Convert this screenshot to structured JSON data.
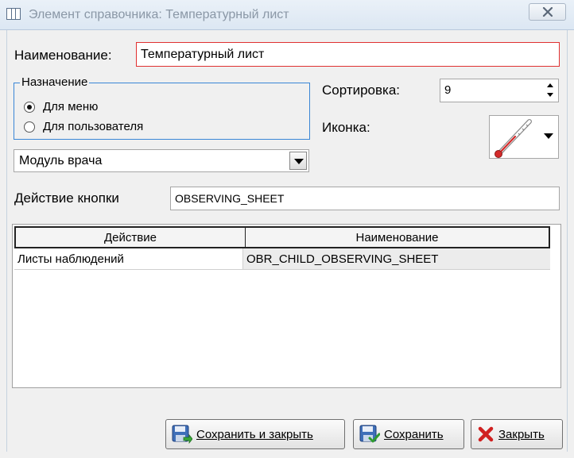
{
  "window": {
    "title": "Элемент справочника: Температурный лист",
    "icon": "table-icon",
    "close_icon": "close-icon"
  },
  "form": {
    "name_label": "Наименование:",
    "name_value": "Температурный лист",
    "purpose": {
      "legend": "Назначение",
      "options": [
        {
          "label": "Для меню",
          "checked": true
        },
        {
          "label": "Для пользователя",
          "checked": false
        }
      ]
    },
    "sort_label": "Сортировка:",
    "sort_value": "9",
    "icon_label": "Иконка:",
    "icon_value": "thermometer-icon",
    "module_value": "Модуль врача",
    "action_label": "Действие кнопки",
    "action_value": "OBSERVING_SHEET"
  },
  "grid": {
    "columns": [
      "Действие",
      "Наименование"
    ],
    "rows": [
      [
        "Листы наблюдений",
        "OBR_CHILD_OBSERVING_SHEET"
      ]
    ]
  },
  "buttons": {
    "save_close": "Сохранить и закрыть",
    "save": "Сохранить",
    "close": "Закрыть"
  },
  "colors": {
    "required_border": "#e03030",
    "focus_border": "#3a86d6"
  }
}
